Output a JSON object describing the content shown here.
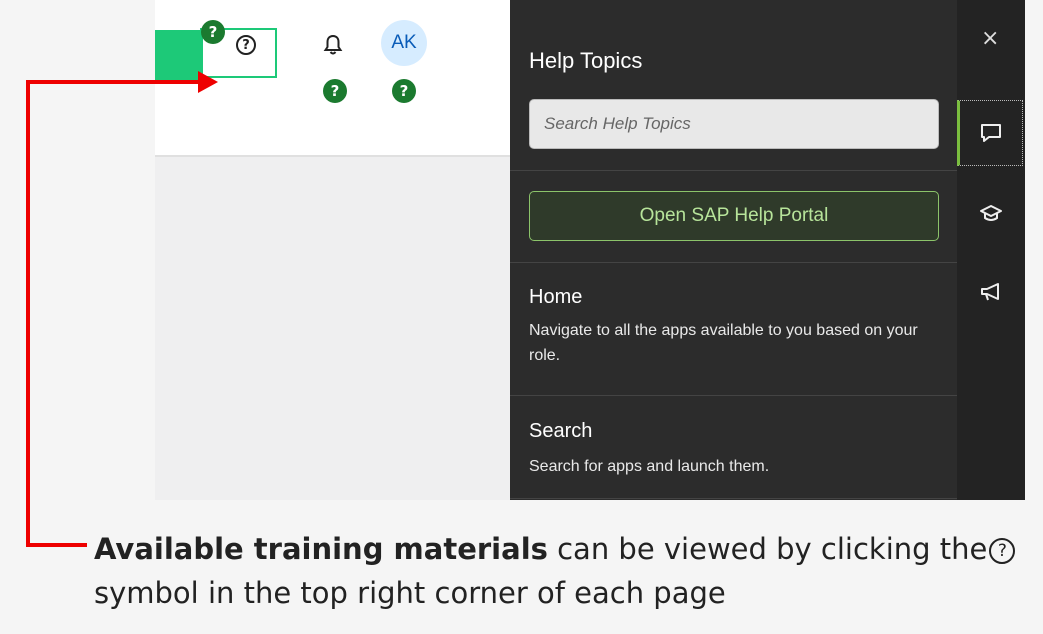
{
  "shellbar": {
    "avatar_initials": "AK",
    "badge_char": "?",
    "help_icon_char": "?"
  },
  "help_panel": {
    "title": "Help Topics",
    "search_placeholder": "Search Help Topics",
    "portal_button": "Open SAP Help Portal",
    "topics": [
      {
        "title": "Home",
        "description": "Navigate to all the apps available to you based on your role."
      },
      {
        "title": "Search",
        "description": "Search for apps and launch them."
      }
    ]
  },
  "rail": {
    "close_char": "×",
    "icons": [
      "chat-icon",
      "graduation-cap-icon",
      "megaphone-icon"
    ]
  },
  "caption": {
    "bold": "Available training materials",
    "text_before_icon": " can be viewed by clicking the",
    "icon_char": "?",
    "text_after_icon": "symbol in the top right corner of each page"
  },
  "colors": {
    "highlight_green": "#1dc978",
    "badge_green": "#1b7a2f",
    "arrow_red": "#e00000",
    "panel_bg": "#2c2c2c",
    "portal_text": "#b7e49a"
  }
}
